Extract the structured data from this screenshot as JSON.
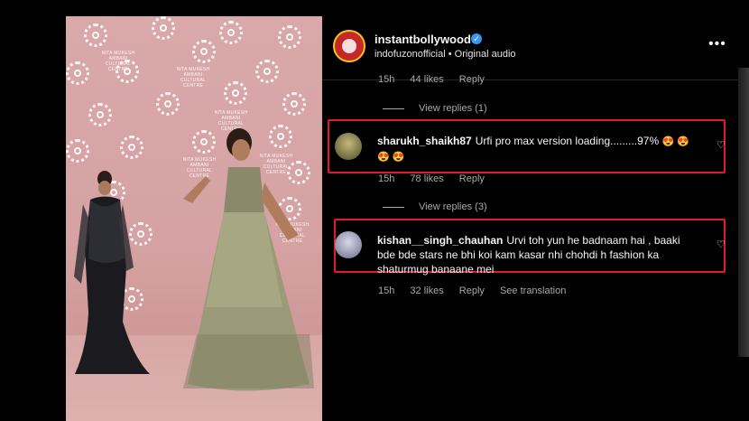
{
  "post": {
    "username": "instantbollywood",
    "audio": "indofuzonofficial • Original audio",
    "more_icon": "•••",
    "verified_icon": "✓"
  },
  "background_marks": {
    "venue_text": "NITA MUKESH AMBANI CULTURAL CENTRE"
  },
  "top_meta": {
    "time": "15h",
    "likes": "44 likes",
    "reply": "Reply"
  },
  "view_replies_1": "View replies (1)",
  "comment_1": {
    "user": "sharukh_shaikh87",
    "text": "Urfi pro max version loading.........97%",
    "emojis_line1": "😍 😍",
    "emojis_line2": "😍 😍",
    "time": "15h",
    "likes": "78 likes",
    "reply": "Reply"
  },
  "view_replies_2": "View replies (3)",
  "comment_2": {
    "user": "kishan__singh_chauhan",
    "text_line1": "Urvi toh yun he badnaam hai , baaki",
    "text_line2": "bde bde stars ne bhi koi kam kasar nhi chohdi h fashion ka",
    "text_line3": "shaturmug banaane mei",
    "time": "15h",
    "likes": "32 likes",
    "reply": "Reply",
    "translate": "See translation"
  },
  "colors": {
    "highlight": "#e21b2a",
    "verified": "#3897f0",
    "meta_text": "#a8a8a8"
  }
}
